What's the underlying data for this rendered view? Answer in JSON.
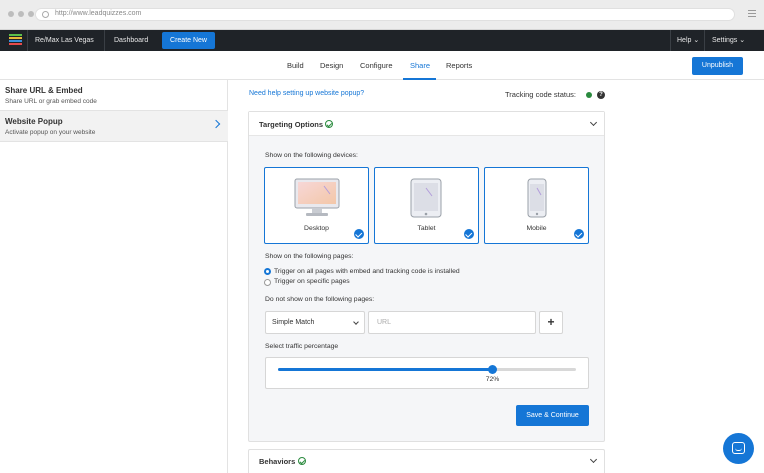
{
  "browser": {
    "url": "http://www.leadquizzes.com"
  },
  "nav": {
    "workspace": "Re/Max Las Vegas",
    "dashboard": "Dashboard",
    "create_new": "Create New",
    "help": "Help",
    "settings": "Settings"
  },
  "tabs": [
    {
      "label": "Build"
    },
    {
      "label": "Design"
    },
    {
      "label": "Configure"
    },
    {
      "label": "Share",
      "active": true
    },
    {
      "label": "Reports"
    }
  ],
  "unpublish": "Unpublish",
  "sidebar": {
    "items": [
      {
        "title": "Share URL & Embed",
        "subtitle": "Share URL or grab embed code"
      },
      {
        "title": "Website Popup",
        "subtitle": "Activate popup on your website",
        "active": true
      }
    ]
  },
  "main": {
    "help_link": "Need help setting up website popup?",
    "tracking_status_label": "Tracking code status:",
    "tracking_status_color": "#2a8a3e",
    "help_icon_glyph": "?",
    "targeting": {
      "title": "Targeting Options",
      "devices_label": "Show on the following devices:",
      "devices": [
        {
          "name": "Desktop",
          "checked": true
        },
        {
          "name": "Tablet",
          "checked": true
        },
        {
          "name": "Mobile",
          "checked": true
        }
      ],
      "pages_label": "Show on the following pages:",
      "page_options": [
        {
          "label": "Trigger on all pages with embed and tracking code is installed",
          "selected": true
        },
        {
          "label": "Trigger on specific pages",
          "selected": false
        }
      ],
      "exclude_label": "Do not show on the following pages:",
      "match_select": "Simple Match",
      "url_placeholder": "URL",
      "add_glyph": "+",
      "traffic_label": "Select traffic percentage",
      "traffic_percent": 72,
      "traffic_display": "72%",
      "save_button": "Save & Continue"
    },
    "behaviors": {
      "title": "Behaviors"
    }
  },
  "colors": {
    "accent": "#1576d6",
    "nav_bg": "#1f2328",
    "success": "#2a8a3e"
  }
}
